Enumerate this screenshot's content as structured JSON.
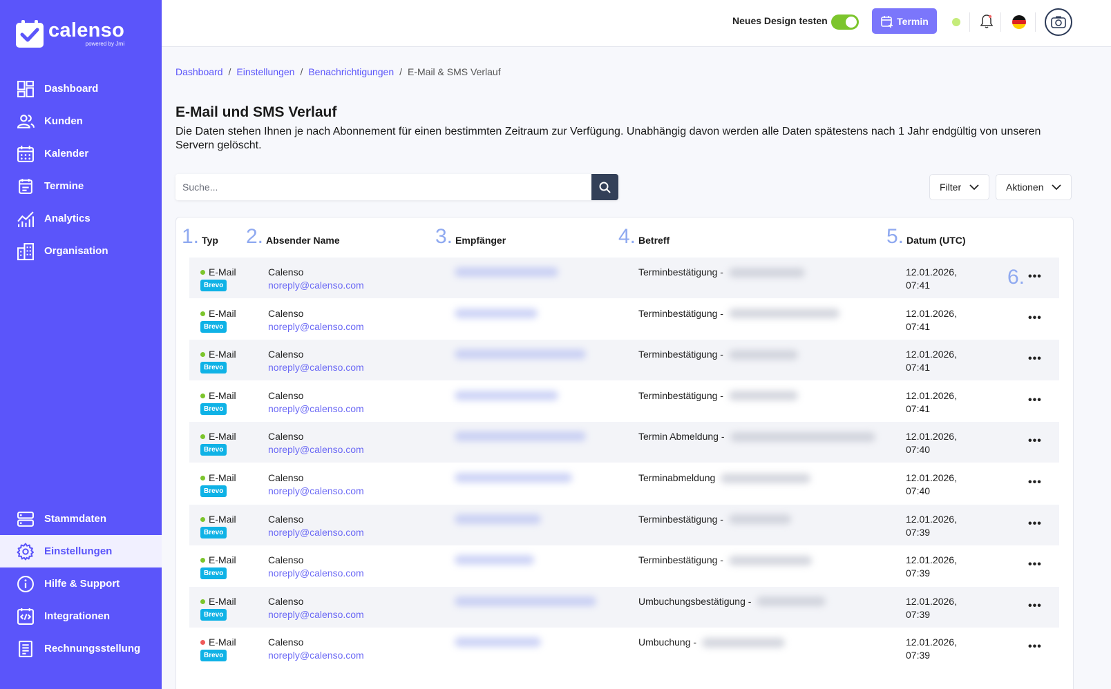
{
  "brand": {
    "name": "calenso",
    "powered": "powered by Jrni",
    "color": "#5b55fa"
  },
  "nav": {
    "top": [
      {
        "id": "dashboard",
        "label": "Dashboard",
        "icon": "dashboard-icon"
      },
      {
        "id": "kunden",
        "label": "Kunden",
        "icon": "users-icon"
      },
      {
        "id": "kalender",
        "label": "Kalender",
        "icon": "calendar-icon"
      },
      {
        "id": "termine",
        "label": "Termine",
        "icon": "appointment-icon"
      },
      {
        "id": "analytics",
        "label": "Analytics",
        "icon": "chart-icon"
      },
      {
        "id": "organisation",
        "label": "Organisation",
        "icon": "building-icon"
      }
    ],
    "bottom": [
      {
        "id": "stammdaten",
        "label": "Stammdaten",
        "icon": "server-icon"
      },
      {
        "id": "einstellungen",
        "label": "Einstellungen",
        "icon": "gear-icon",
        "active": true
      },
      {
        "id": "hilfe",
        "label": "Hilfe & Support",
        "icon": "info-icon"
      },
      {
        "id": "integrationen",
        "label": "Integrationen",
        "icon": "code-icon"
      },
      {
        "id": "rechnung",
        "label": "Rechnungsstellung",
        "icon": "invoice-icon"
      }
    ]
  },
  "topbar": {
    "new_design_label": "Neues Design testen",
    "new_design_enabled": true,
    "termin_button": "Termin",
    "status_color": "#c5ec7a",
    "language": "de"
  },
  "breadcrumb": {
    "items": [
      "Dashboard",
      "Einstellungen",
      "Benachrichtigungen"
    ],
    "current": "E-Mail & SMS Verlauf",
    "separator": "/"
  },
  "page": {
    "title": "E-Mail und SMS Verlauf",
    "description": "Die Daten stehen Ihnen je nach Abonnement für einen bestimmten Zeitraum zur Verfügung. Unabhängig davon werden alle Daten spätestens nach 1 Jahr endgültig von unseren Servern gelöscht."
  },
  "search": {
    "placeholder": "Suche..."
  },
  "toolbar": {
    "filter_label": "Filter",
    "actions_label": "Aktionen"
  },
  "table": {
    "columns": [
      {
        "num": "1.",
        "label": "Typ"
      },
      {
        "num": "2.",
        "label": "Absender Name"
      },
      {
        "num": "3.",
        "label": "Empfänger"
      },
      {
        "num": "4.",
        "label": "Betreff"
      },
      {
        "num": "5.",
        "label": "Datum (UTC)"
      }
    ],
    "actions_marker": "6.",
    "rows": [
      {
        "type": "E-Mail",
        "status": "ok",
        "provider": "Brevo",
        "sender_name": "Calenso",
        "sender_email": "noreply@calenso.com",
        "subject": "Terminbestätigung -",
        "date": "12.01.2026,",
        "time": "07:41"
      },
      {
        "type": "E-Mail",
        "status": "ok",
        "provider": "Brevo",
        "sender_name": "Calenso",
        "sender_email": "noreply@calenso.com",
        "subject": "Terminbestätigung -",
        "date": "12.01.2026,",
        "time": "07:41"
      },
      {
        "type": "E-Mail",
        "status": "ok",
        "provider": "Brevo",
        "sender_name": "Calenso",
        "sender_email": "noreply@calenso.com",
        "subject": "Terminbestätigung -",
        "date": "12.01.2026,",
        "time": "07:41"
      },
      {
        "type": "E-Mail",
        "status": "ok",
        "provider": "Brevo",
        "sender_name": "Calenso",
        "sender_email": "noreply@calenso.com",
        "subject": "Terminbestätigung -",
        "date": "12.01.2026,",
        "time": "07:41"
      },
      {
        "type": "E-Mail",
        "status": "ok",
        "provider": "Brevo",
        "sender_name": "Calenso",
        "sender_email": "noreply@calenso.com",
        "subject": "Termin Abmeldung -",
        "date": "12.01.2026,",
        "time": "07:40"
      },
      {
        "type": "E-Mail",
        "status": "ok",
        "provider": "Brevo",
        "sender_name": "Calenso",
        "sender_email": "noreply@calenso.com",
        "subject": "Terminabmeldung",
        "date": "12.01.2026,",
        "time": "07:40"
      },
      {
        "type": "E-Mail",
        "status": "ok",
        "provider": "Brevo",
        "sender_name": "Calenso",
        "sender_email": "noreply@calenso.com",
        "subject": "Terminbestätigung -",
        "date": "12.01.2026,",
        "time": "07:39"
      },
      {
        "type": "E-Mail",
        "status": "ok",
        "provider": "Brevo",
        "sender_name": "Calenso",
        "sender_email": "noreply@calenso.com",
        "subject": "Terminbestätigung -",
        "date": "12.01.2026,",
        "time": "07:39"
      },
      {
        "type": "E-Mail",
        "status": "ok",
        "provider": "Brevo",
        "sender_name": "Calenso",
        "sender_email": "noreply@calenso.com",
        "subject": "Umbuchungsbestätigung -",
        "date": "12.01.2026,",
        "time": "07:39"
      },
      {
        "type": "E-Mail",
        "status": "error",
        "provider": "Brevo",
        "sender_name": "Calenso",
        "sender_email": "noreply@calenso.com",
        "subject": "Umbuchung -",
        "date": "12.01.2026,",
        "time": "07:39"
      }
    ],
    "row_more_label": "•••"
  },
  "colors": {
    "ok": "#7cc52c",
    "error": "#f05a5a",
    "badge": "#0fb2e6",
    "annotation": "#8fa9f0"
  }
}
